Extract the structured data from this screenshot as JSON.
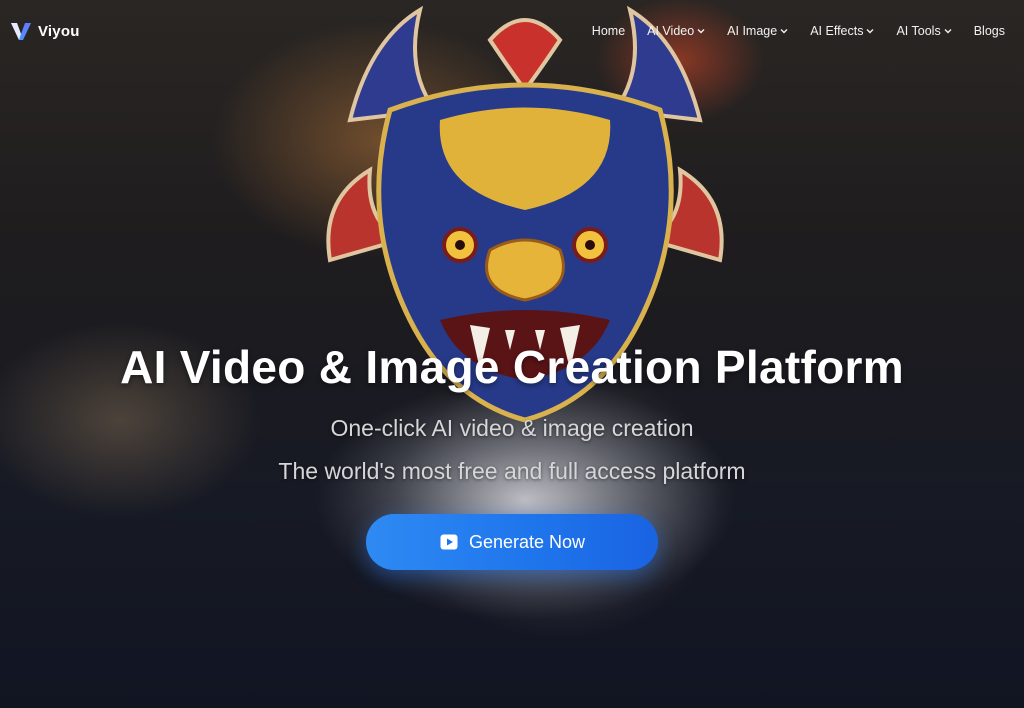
{
  "brand": {
    "name": "Viyou",
    "logo_icon": "viyou-v-logo-icon"
  },
  "nav": {
    "items": [
      {
        "label": "Home",
        "dropdown": false
      },
      {
        "label": "AI Video",
        "dropdown": true
      },
      {
        "label": "AI Image",
        "dropdown": true
      },
      {
        "label": "AI Effects",
        "dropdown": true
      },
      {
        "label": "AI Tools",
        "dropdown": true
      },
      {
        "label": "Blogs",
        "dropdown": false
      }
    ]
  },
  "hero": {
    "title": "AI Video & Image Creation Platform",
    "subtitle_line1": "One-click AI video & image creation",
    "subtitle_line2": "The world's most free and full access platform",
    "cta_label": "Generate Now",
    "cta_icon": "play-square-icon"
  },
  "colors": {
    "cta_start": "#2f8af3",
    "cta_end": "#1a63e2",
    "background": "#121522"
  }
}
